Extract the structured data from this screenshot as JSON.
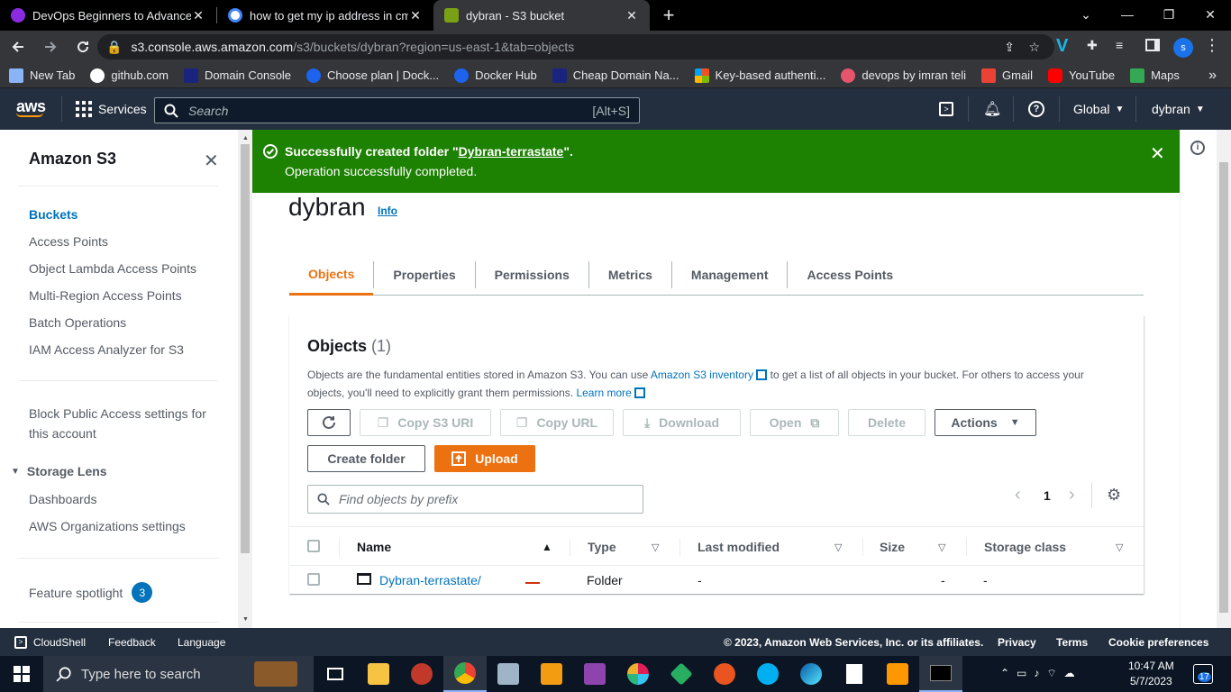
{
  "browser": {
    "tabs": [
      {
        "title": "DevOps Beginners to Advanced |",
        "color": "#8a2be2"
      },
      {
        "title": "how to get my ip address in cmd",
        "color": "#ffffff"
      },
      {
        "title": "dybran - S3 bucket",
        "color": "#7aa116"
      }
    ],
    "url_host": "s3.console.aws.amazon.com",
    "url_path": "/s3/buckets/dybran?region=us-east-1&tab=objects",
    "profile_initial": "s",
    "bookmarks": [
      {
        "label": "New Tab",
        "icon": "grid-icon",
        "color": "#8ab4f8"
      },
      {
        "label": "github.com",
        "icon": "github-icon",
        "color": "#ffffff"
      },
      {
        "label": "Domain Console",
        "icon": "domain-icon",
        "color": "#1a237e"
      },
      {
        "label": "Choose plan | Dock...",
        "icon": "docker-icon",
        "color": "#1d63ed"
      },
      {
        "label": "Docker Hub",
        "icon": "docker-icon",
        "color": "#1d63ed"
      },
      {
        "label": "Cheap Domain Na...",
        "icon": "domain-icon",
        "color": "#1a237e"
      },
      {
        "label": "Key-based authenti...",
        "icon": "microsoft-icon",
        "color": "#f25022"
      },
      {
        "label": "devops by imran teli",
        "icon": "circle-icon",
        "color": "#e5566d"
      },
      {
        "label": "Gmail",
        "icon": "gmail-icon",
        "color": "#ea4335"
      },
      {
        "label": "YouTube",
        "icon": "youtube-icon",
        "color": "#ff0000"
      },
      {
        "label": "Maps",
        "icon": "maps-icon",
        "color": "#34a853"
      }
    ]
  },
  "aws_header": {
    "logo": "aws",
    "services_label": "Services",
    "search_placeholder": "Search",
    "search_shortcut": "[Alt+S]",
    "region": "Global",
    "user": "dybran"
  },
  "sidebar": {
    "title": "Amazon S3",
    "items": [
      {
        "label": "Buckets",
        "active": true
      },
      {
        "label": "Access Points"
      },
      {
        "label": "Object Lambda Access Points"
      },
      {
        "label": "Multi-Region Access Points"
      },
      {
        "label": "Batch Operations"
      },
      {
        "label": "IAM Access Analyzer for S3"
      }
    ],
    "block_public_line1": "Block Public Access settings for",
    "block_public_line2": "this account",
    "storage_lens_title": "Storage Lens",
    "storage_lens_items": [
      "Dashboards",
      "AWS Organizations settings"
    ],
    "feature_spotlight": "Feature spotlight",
    "feature_spotlight_count": "3"
  },
  "flash": {
    "title_prefix": "Successfully created folder \"",
    "folder_name": "Dybran-terrastate",
    "title_suffix": "\".",
    "message": "Operation successfully completed."
  },
  "bucket": {
    "name": "dybran",
    "info_link": "Info",
    "tabs": [
      "Objects",
      "Properties",
      "Permissions",
      "Metrics",
      "Management",
      "Access Points"
    ]
  },
  "objects": {
    "heading": "Objects",
    "count": "(1)",
    "desc_part1": "Objects are the fundamental entities stored in Amazon S3. You can use ",
    "desc_link": "Amazon S3 inventory",
    "desc_part2": " to get a list of all objects in your bucket. For others to access your",
    "desc_part3": "objects, you'll need to explicitly grant them permissions. ",
    "learn_more": "Learn more",
    "buttons": {
      "copy_uri": "Copy S3 URI",
      "copy_url": "Copy URL",
      "download": "Download",
      "open": "Open",
      "delete": "Delete",
      "actions": "Actions",
      "create_folder": "Create folder",
      "upload": "Upload"
    },
    "filter_placeholder": "Find objects by prefix",
    "page": "1",
    "columns": [
      "Name",
      "Type",
      "Last modified",
      "Size",
      "Storage class"
    ],
    "rows": [
      {
        "name": "Dybran-terrastate/",
        "type": "Folder",
        "last_modified": "-",
        "size": "-",
        "storage_class": "-"
      }
    ]
  },
  "footer": {
    "cloudshell": "CloudShell",
    "feedback": "Feedback",
    "language": "Language",
    "copyright": "© 2023, Amazon Web Services, Inc. or its affiliates.",
    "privacy": "Privacy",
    "terms": "Terms",
    "cookie": "Cookie preferences"
  },
  "taskbar": {
    "search_placeholder": "Type here to search",
    "time": "10:47 AM",
    "date": "5/7/2023",
    "notification_count": "17"
  }
}
